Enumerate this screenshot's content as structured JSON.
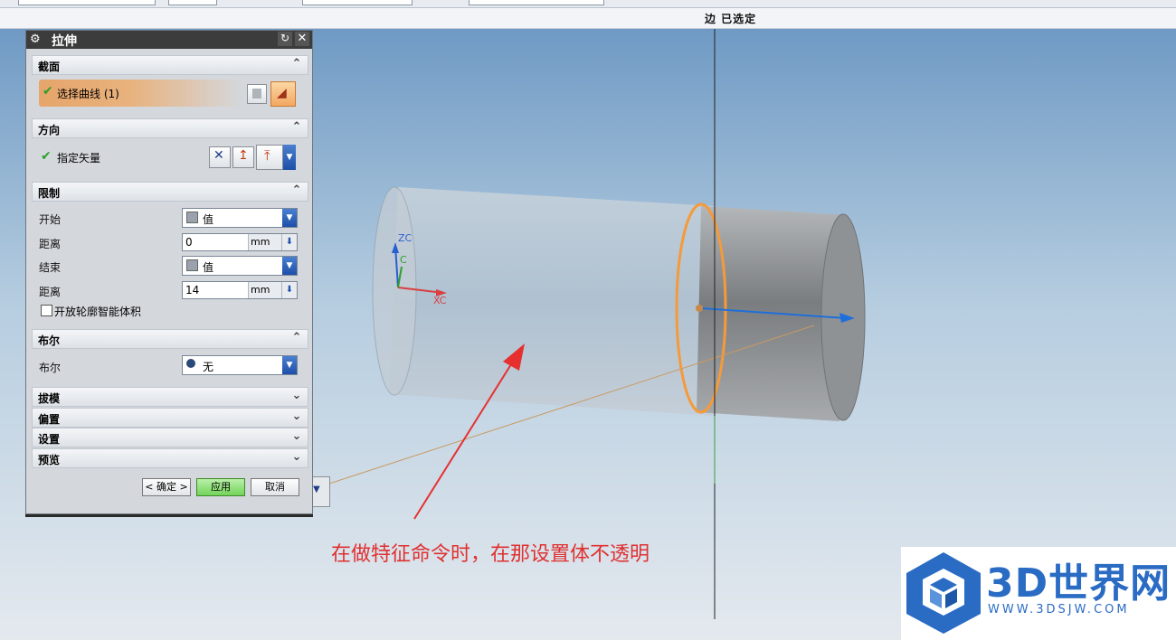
{
  "status_bar": {
    "text": "边 已选定"
  },
  "dialog": {
    "title": "拉伸",
    "sections": {
      "section": {
        "label": "截面",
        "select_curve": "选择曲线 (1)"
      },
      "direction": {
        "label": "方向",
        "specify_vector": "指定矢量"
      },
      "limits": {
        "label": "限制",
        "start_label": "开始",
        "start_value": "值",
        "start_distance_label": "距离",
        "start_distance": "0",
        "end_label": "结束",
        "end_value": "值",
        "end_distance_label": "距离",
        "end_distance": "14",
        "unit": "mm",
        "open_profile": "开放轮廓智能体积"
      },
      "boolean": {
        "label": "布尔",
        "row_label": "布尔",
        "value": "无"
      },
      "draft": {
        "label": "拔模"
      },
      "offset": {
        "label": "偏置"
      },
      "settings": {
        "label": "设置"
      },
      "preview": {
        "label": "预览"
      }
    },
    "buttons": {
      "ok": "< 确定 >",
      "apply": "应用",
      "cancel": "取消"
    }
  },
  "viewport": {
    "axes": {
      "zc": "ZC",
      "c": "C",
      "xc": "XC"
    },
    "colors": {
      "edge_highlight": "#f59a3a",
      "vector": "#1e6fd9",
      "annotation": "#e03030"
    }
  },
  "annotation": "在做特征命令时，在那设置体不透明",
  "watermark": {
    "title": "3D世界网",
    "url": "WWW.3DSJW.COM"
  }
}
